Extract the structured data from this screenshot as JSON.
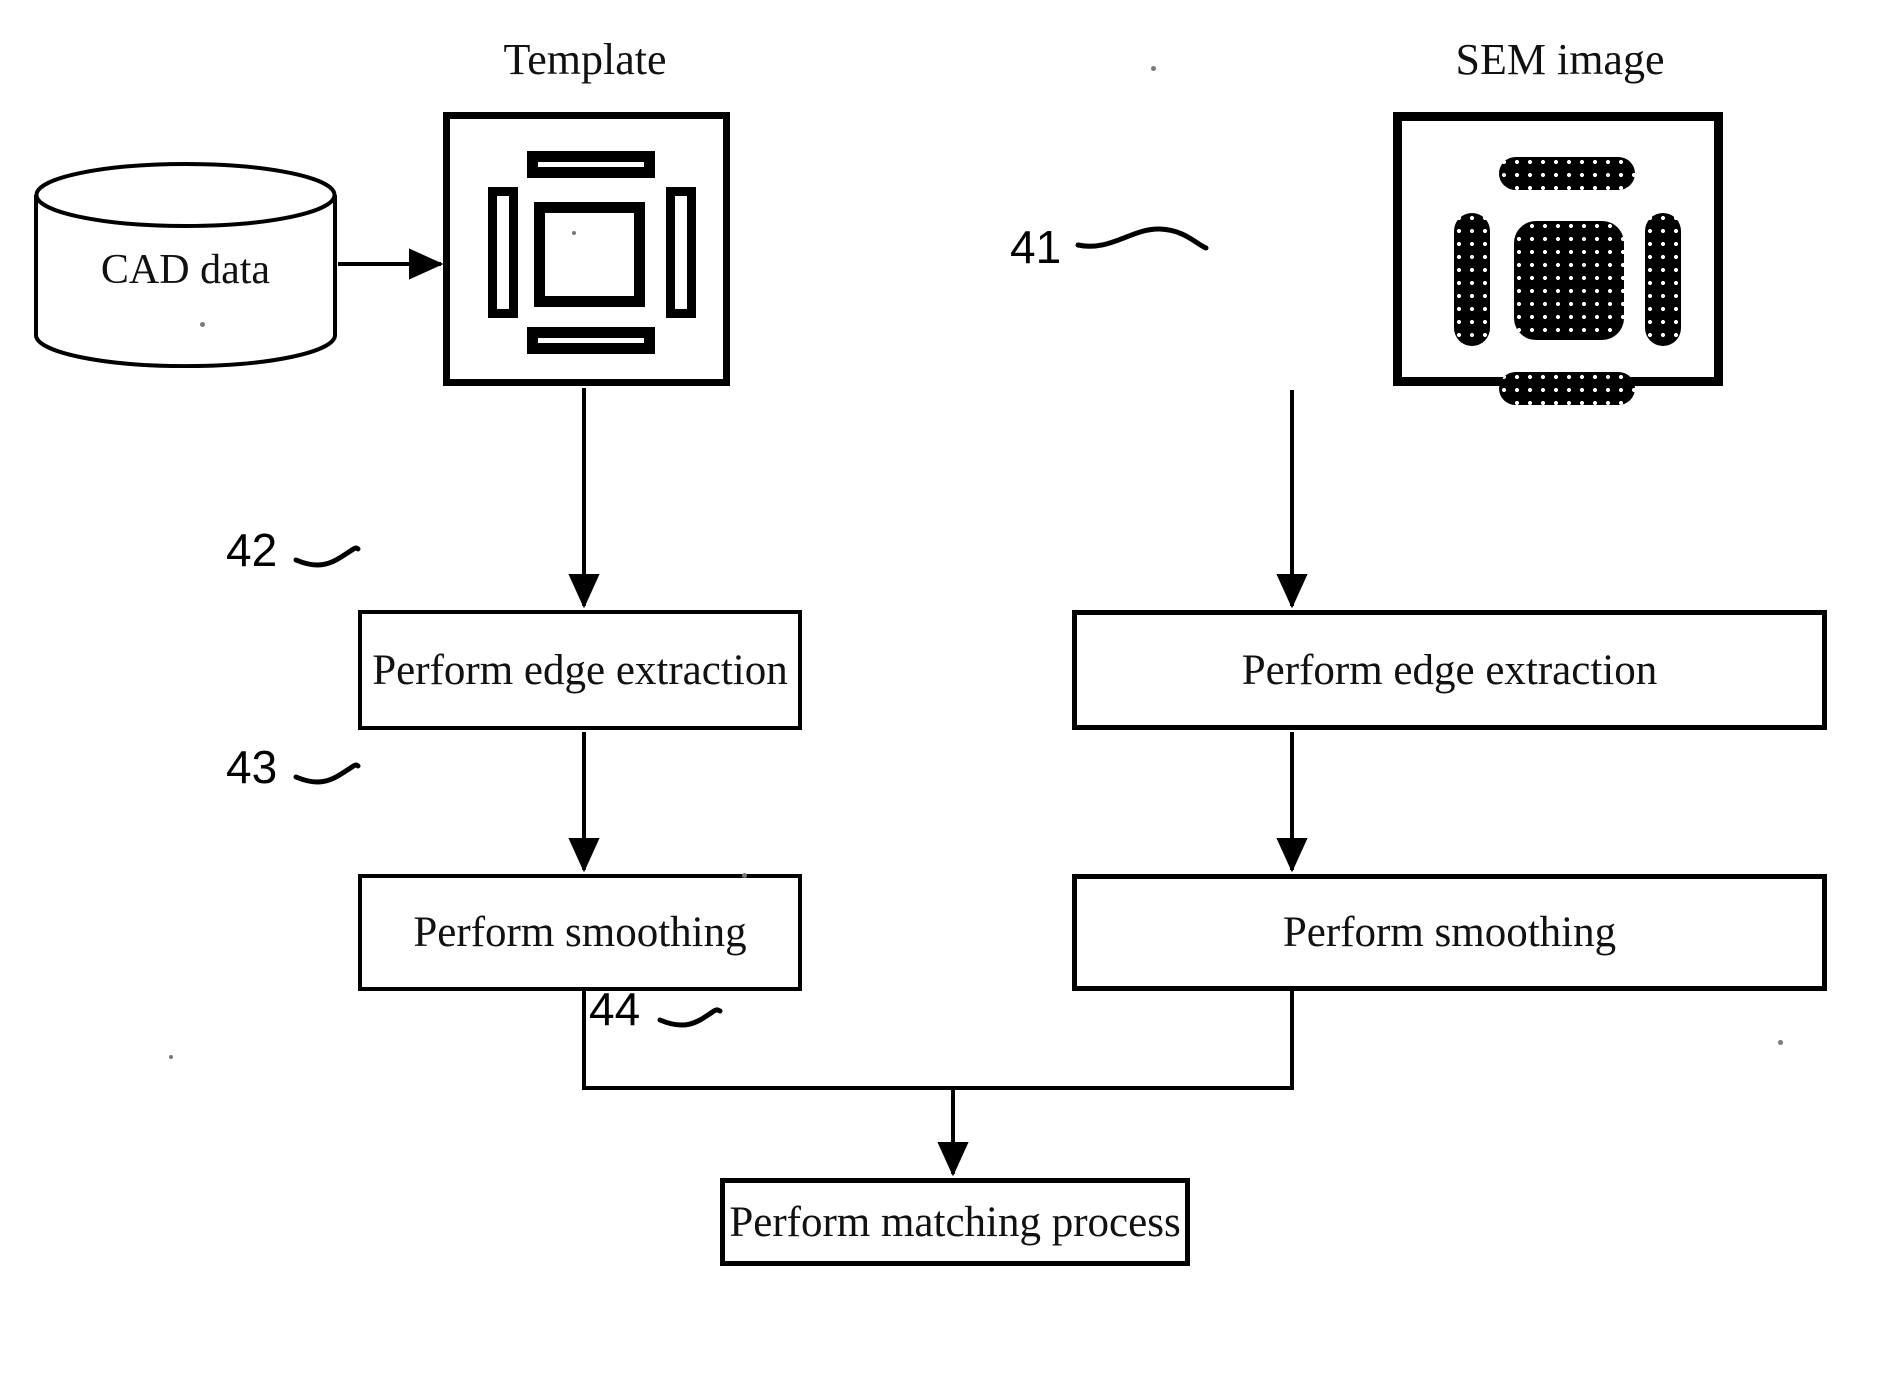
{
  "figure": {
    "headings": {
      "template": "Template",
      "sem": "SEM image"
    },
    "source": {
      "label": "CAD data"
    },
    "reference_numerals": {
      "sem_image": "41",
      "edge_extraction": "42",
      "smoothing": "43",
      "matching": "44"
    },
    "left_branch": {
      "step1": "Perform edge extraction",
      "step2": "Perform smoothing"
    },
    "right_branch": {
      "step1": "Perform edge extraction",
      "step2": "Perform smoothing"
    },
    "merge": {
      "final_step": "Perform matching process"
    },
    "colors": {
      "ink": "#000000",
      "paper": "#ffffff"
    }
  }
}
